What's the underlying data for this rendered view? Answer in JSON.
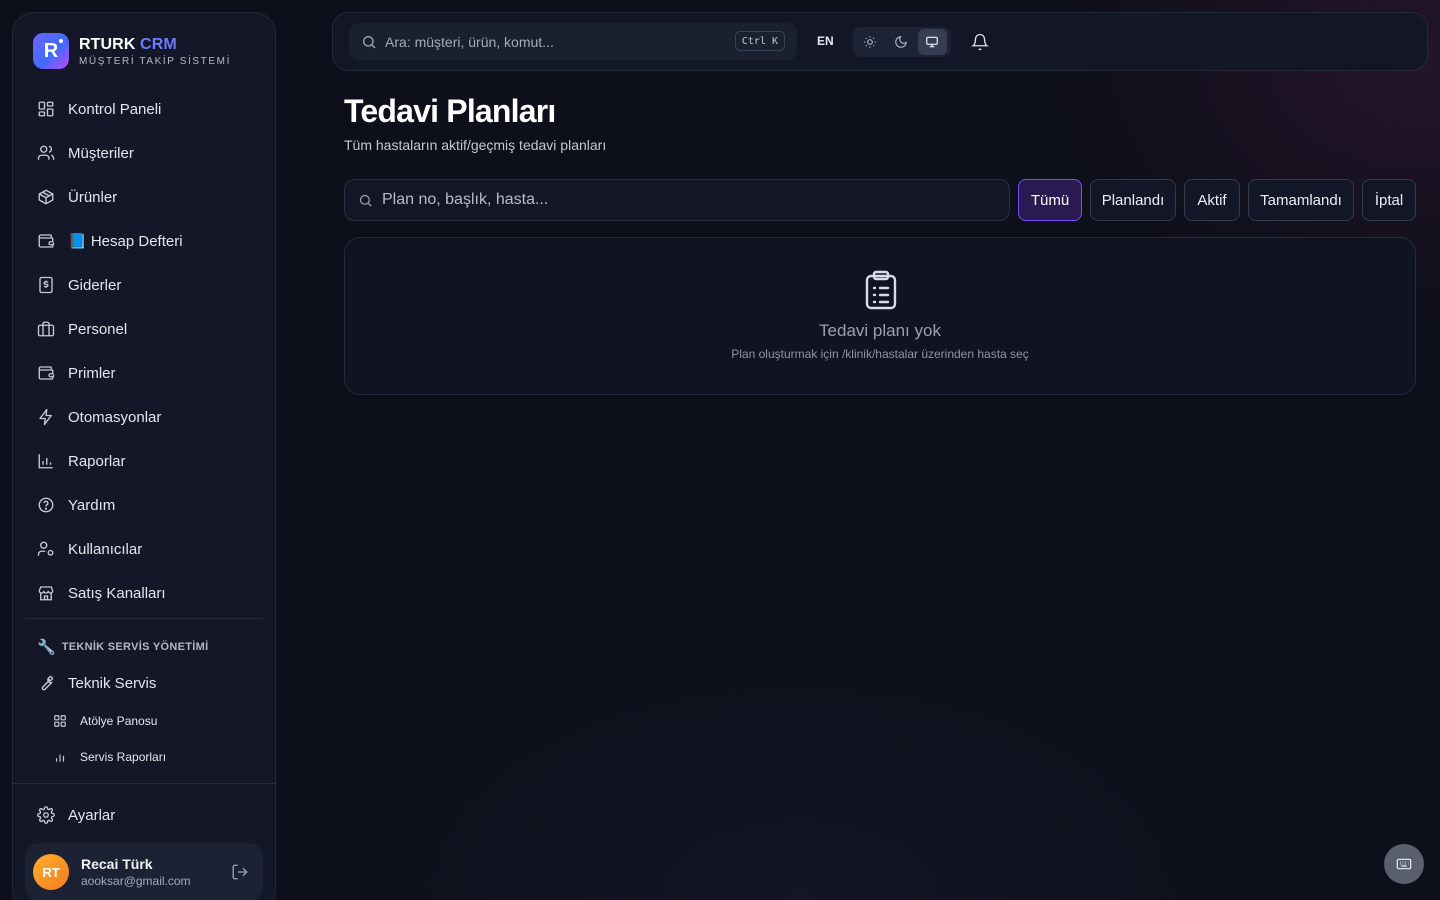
{
  "brand": {
    "logo_letter": "R",
    "name_primary": "RTURK",
    "name_accent": "CRM",
    "subtitle": "MÜŞTERİ TAKİP SİSTEMİ",
    "accent_color": "#6c7bff"
  },
  "sidebar": {
    "items": [
      {
        "label": "Kontrol Paneli",
        "icon": "dashboard-icon"
      },
      {
        "label": "Müşteriler",
        "icon": "users-icon"
      },
      {
        "label": "Ürünler",
        "icon": "package-icon"
      },
      {
        "label": "📘 Hesap Defteri",
        "icon": "wallet-icon"
      },
      {
        "label": "Giderler",
        "icon": "receipt-dollar-icon"
      },
      {
        "label": "Personel",
        "icon": "briefcase-icon"
      },
      {
        "label": "Primler",
        "icon": "wallet-icon"
      },
      {
        "label": "Otomasyonlar",
        "icon": "lightning-icon"
      },
      {
        "label": "Raporlar",
        "icon": "bar-chart-icon"
      },
      {
        "label": "Yardım",
        "icon": "help-circle-icon"
      },
      {
        "label": "Kullanıcılar",
        "icon": "user-cog-icon"
      },
      {
        "label": "Satış Kanalları",
        "icon": "store-icon"
      }
    ],
    "section": {
      "emoji": "🔧",
      "title": "TEKNİK SERVİS YÖNETİMİ"
    },
    "section_item": {
      "label": "Teknik Servis",
      "icon": "wrench-icon"
    },
    "sub_items": [
      {
        "label": "Atölye Panosu",
        "icon": "grid-icon"
      },
      {
        "label": "Servis Raporları",
        "icon": "bar-chart-icon"
      }
    ],
    "settings": {
      "label": "Ayarlar",
      "icon": "gear-icon"
    },
    "user": {
      "initials": "RT",
      "name": "Recai Türk",
      "email": "aooksar@gmail.com"
    }
  },
  "topbar": {
    "search_placeholder": "Ara: müşteri, ürün, komut...",
    "shortcut": "Ctrl K",
    "language": "EN",
    "theme_options": [
      "light",
      "dark",
      "system"
    ],
    "theme_selected": "system"
  },
  "page": {
    "title": "Tedavi Planları",
    "subtitle": "Tüm hastaların aktif/geçmiş tedavi planları",
    "search_placeholder": "Plan no, başlık, hasta...",
    "filters": [
      "Tümü",
      "Planlandı",
      "Aktif",
      "Tamamlandı",
      "İptal"
    ],
    "active_filter": "Tümü",
    "empty_title": "Tedavi planı yok",
    "empty_desc": "Plan oluşturmak için /klinik/hastalar üzerinden hasta seç"
  },
  "colors": {
    "background": "#0d0f1a",
    "panel": "#131727",
    "active_filter_bg": "#2a1a52",
    "active_filter_border": "#7c4dff"
  }
}
